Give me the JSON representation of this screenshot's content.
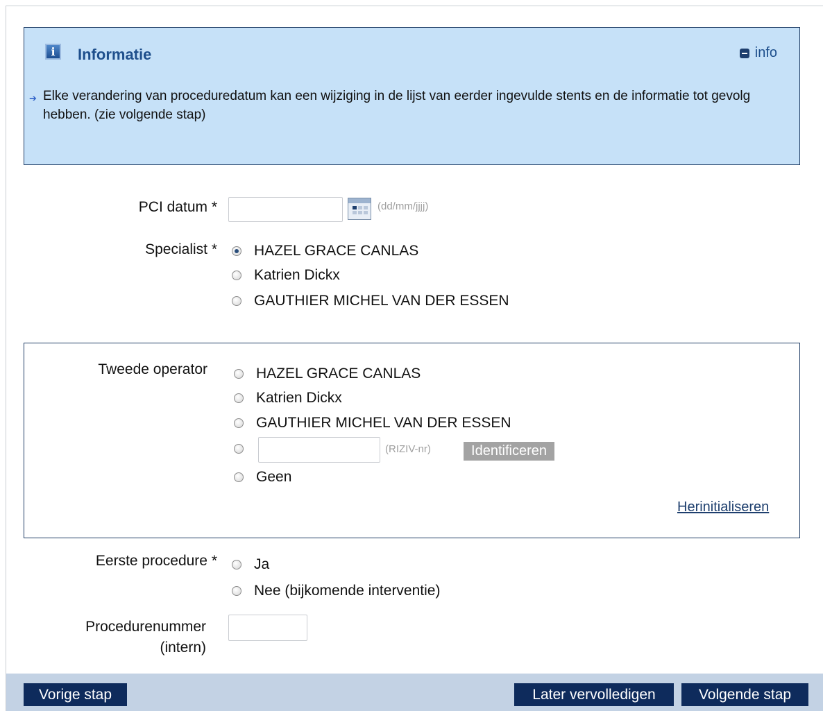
{
  "info": {
    "title": "Informatie",
    "toggle_label": "info",
    "message": "Elke verandering van proceduredatum kan een wijziging in de lijst van eerder ingevulde stents en de informatie tot gevolg hebben. (zie volgende stap)"
  },
  "pci_date": {
    "label": "PCI datum *",
    "value": "",
    "format_hint": "(dd/mm/jjjj)"
  },
  "specialist": {
    "label": "Specialist *",
    "options": [
      "HAZEL GRACE  CANLAS",
      "Katrien  Dickx",
      "GAUTHIER MICHEL  VAN DER ESSEN"
    ],
    "selected_index": 0
  },
  "second_operator": {
    "label": "Tweede operator",
    "options": [
      "HAZEL GRACE  CANLAS",
      "Katrien  Dickx",
      "GAUTHIER MICHEL  VAN DER ESSEN"
    ],
    "riziv_hint": "(RIZIV-nr)",
    "identify_label": "Identificeren",
    "none_label": "Geen",
    "reset_label": "Herinitialiseren"
  },
  "first_procedure": {
    "label": "Eerste procedure *",
    "options": [
      "Ja",
      "Nee (bijkomende interventie)"
    ]
  },
  "procedure_number": {
    "label_line1": "Procedurenummer",
    "label_line2": "(intern)",
    "value": ""
  },
  "footer": {
    "prev_label": "Vorige stap",
    "later_label": "Later vervolledigen",
    "next_label": "Volgende stap"
  },
  "colors": {
    "info_background": "#c6e1f8",
    "navy": "#0e2b5c",
    "footer_bar": "#c3d2e4"
  }
}
